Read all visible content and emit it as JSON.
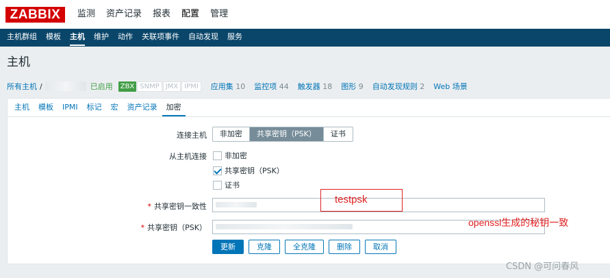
{
  "header": {
    "logo": "ZABBIX",
    "nav": [
      "监测",
      "资产记录",
      "报表",
      "配置",
      "管理"
    ],
    "active_nav": "配置"
  },
  "subnav": {
    "items": [
      "主机群组",
      "模板",
      "主机",
      "维护",
      "动作",
      "关联项事件",
      "自动发现",
      "服务"
    ],
    "active": "主机"
  },
  "page_title": "主机",
  "hostbar": {
    "all_hosts": "所有主机",
    "separator": "/",
    "status": "已启用",
    "badges": [
      {
        "label": "ZBX",
        "on": true
      },
      {
        "label": "SNMP",
        "on": false
      },
      {
        "label": "JMX",
        "on": false
      },
      {
        "label": "IPMI",
        "on": false
      }
    ],
    "items": [
      {
        "label": "应用集",
        "count": "10"
      },
      {
        "label": "监控项",
        "count": "44"
      },
      {
        "label": "触发器",
        "count": "18"
      },
      {
        "label": "图形",
        "count": "9"
      },
      {
        "label": "自动发现规则",
        "count": "2"
      },
      {
        "label": "Web 场景",
        "count": ""
      }
    ]
  },
  "tabs": {
    "items": [
      "主机",
      "模板",
      "IPMI",
      "标记",
      "宏",
      "资产记录",
      "加密"
    ],
    "active": "加密"
  },
  "form": {
    "connect_to_host_label": "连接主机",
    "connect_options": [
      "非加密",
      "共享密钥（PSK）",
      "证书"
    ],
    "connect_selected": "共享密钥（PSK）",
    "connect_from_host_label": "从主机连接",
    "from_options": [
      {
        "label": "非加密",
        "checked": false
      },
      {
        "label": "共享密钥（PSK）",
        "checked": true
      },
      {
        "label": "证书",
        "checked": false
      }
    ],
    "psk_identity_label": "共享密钥一致性",
    "psk_label": "共享密钥（PSK）",
    "required_mark": "*"
  },
  "annotations": {
    "psk_identity_note": "testpsk",
    "psk_note": "openssl生成的秘钥一致"
  },
  "buttons": {
    "update": "更新",
    "clone": "克隆",
    "full_clone": "全克隆",
    "delete": "删除",
    "cancel": "取消"
  },
  "watermark": "CSDN @可问春风",
  "colors": {
    "brand_red": "#d40000",
    "nav_blue": "#0a466a",
    "link_blue": "#0275b8",
    "enabled_green": "#429e47",
    "annotation_red": "#e02020"
  }
}
